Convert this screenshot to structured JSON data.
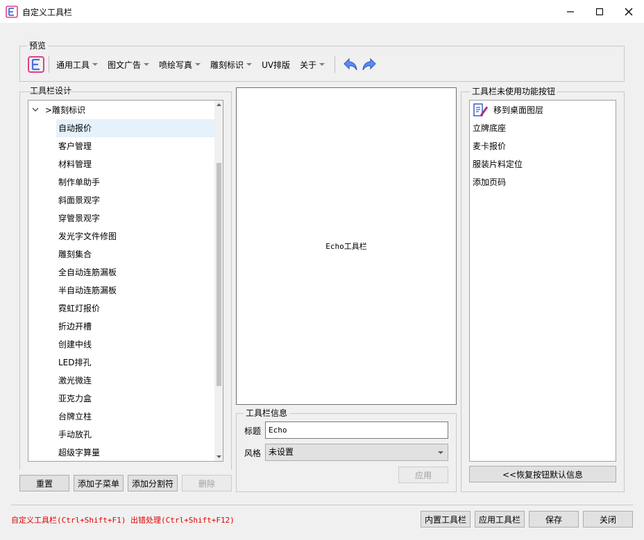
{
  "window": {
    "title": "自定义工具栏",
    "minimize_icon": "minimize-icon",
    "maximize_icon": "maximize-icon",
    "close_icon": "close-icon"
  },
  "preview": {
    "legend": "预览",
    "menus": [
      {
        "label": "通用工具",
        "has_dropdown": true
      },
      {
        "label": "图文广告",
        "has_dropdown": true
      },
      {
        "label": "喷绘写真",
        "has_dropdown": true
      },
      {
        "label": "雕刻标识",
        "has_dropdown": true
      },
      {
        "label": "UV排版",
        "has_dropdown": false
      },
      {
        "label": "关于",
        "has_dropdown": true
      }
    ]
  },
  "designer": {
    "legend": "工具栏设计",
    "root": {
      "expander": "chevron-down-icon",
      "label": ">雕刻标识"
    },
    "selected_index": 0,
    "items": [
      "自动报价",
      "客户管理",
      "材料管理",
      "制作单助手",
      "斜面景观字",
      "穿管景观字",
      "发光字文件修图",
      "雕刻集合",
      "全自动连筋漏板",
      "半自动连筋漏板",
      "霓虹灯报价",
      "折边开槽",
      "创建中线",
      "LED排孔",
      "激光微连",
      "亚克力盒",
      "台牌立柱",
      "手动放孔",
      "超级字算量"
    ],
    "buttons": {
      "reset": "重置",
      "add_submenu": "添加子菜单",
      "add_separator": "添加分割符",
      "delete": "删除"
    }
  },
  "canvas": {
    "label": "Echo工具栏"
  },
  "info": {
    "legend": "工具栏信息",
    "title_label": "标题",
    "title_value": "Echo",
    "style_label": "风格",
    "style_value": "未设置",
    "apply_button": "应用"
  },
  "unused": {
    "legend": "工具栏未使用功能按钮",
    "items": [
      "移到桌面图层",
      "立牌底座",
      "麦卡报价",
      "服装片料定位",
      "添加页码"
    ],
    "restore_button": "<<恢复按钮默认信息"
  },
  "footer": {
    "shortcut_hint": "自定义工具栏(Ctrl+Shift+F1)  出错处理(Ctrl+Shift+F12)",
    "builtin_button": "内置工具栏",
    "apply_toolbar_button": "应用工具栏",
    "save_button": "保存",
    "close_button": "关闭"
  },
  "colors": {
    "accent": "#4a7ee8",
    "hint_red": "#e00000",
    "selected_row": "#e5f1fb"
  }
}
